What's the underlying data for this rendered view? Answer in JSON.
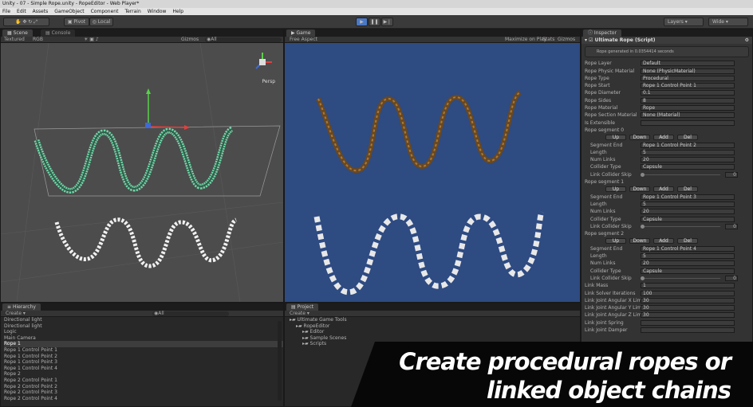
{
  "window": {
    "title": "Unity - 07 - Simple Rope.unity - RopeEditor - Web Player*"
  },
  "menu": [
    "File",
    "Edit",
    "Assets",
    "GameObject",
    "Component",
    "Terrain",
    "Window",
    "Help"
  ],
  "toolbar": {
    "pivot": "Pivot",
    "local": "Local",
    "layers": "Layers",
    "layout": "Wide"
  },
  "scene": {
    "tab": "Scene",
    "tab2": "Console",
    "mode": "Textured",
    "color": "RGB",
    "gizmos": "Gizmos",
    "search": "◉All",
    "persp": "Persp"
  },
  "game": {
    "tab": "Game",
    "aspect": "Free Aspect",
    "maximize": "Maximize on Play",
    "stats": "Stats",
    "gizmos": "Gizmos"
  },
  "inspector": {
    "tab": "Inspector",
    "component": "Ultimate Rope (Script)",
    "info": "Rope generated in 0.0354414 seconds",
    "fields": [
      {
        "label": "Rope Layer",
        "value": "Default"
      },
      {
        "label": "Rope Physic Material",
        "value": "None (PhysicMaterial)"
      },
      {
        "label": "Rope Type",
        "value": "Procedural"
      },
      {
        "label": "Rope Start",
        "value": "Rope 1 Control Point 1"
      },
      {
        "label": "Rope Diameter",
        "value": "0.1"
      },
      {
        "label": "Rope Sides",
        "value": "8"
      },
      {
        "label": "Rope Material",
        "value": "Rope"
      },
      {
        "label": "Rope Section Material",
        "value": "None (Material)"
      },
      {
        "label": "Is Extensible",
        "value": ""
      }
    ],
    "segments": [
      {
        "title": "Rope segment 0",
        "end": "Rope 1 Control Point 2",
        "length": "5",
        "links": "20",
        "collider": "Capsule",
        "skip": "0"
      },
      {
        "title": "Rope segment 1",
        "end": "Rope 1 Control Point 3",
        "length": "5",
        "links": "20",
        "collider": "Capsule",
        "skip": "0"
      },
      {
        "title": "Rope segment 2",
        "end": "Rope 1 Control Point 4",
        "length": "5",
        "links": "20",
        "collider": "Capsule",
        "skip": "0"
      }
    ],
    "labels": {
      "end": "Segment End",
      "length": "Length",
      "links": "Num Links",
      "collider": "Collider Type",
      "skip": "Link Collider Skip",
      "up": "Up",
      "down": "Down",
      "add": "Add",
      "del": "Del"
    },
    "bottom": [
      {
        "label": "Link Mass",
        "value": "1"
      },
      {
        "label": "Link Solver Iterations",
        "value": "100"
      },
      {
        "label": "Link Joint Angular X Limit",
        "value": "30"
      },
      {
        "label": "Link Joint Angular Y Limit",
        "value": "30"
      },
      {
        "label": "Link Joint Angular Z Limit",
        "value": "30"
      },
      {
        "label": "Link Joint Spring",
        "value": ""
      },
      {
        "label": "Link Joint Damper",
        "value": ""
      }
    ]
  },
  "hierarchy": {
    "tab": "Hierarchy",
    "create": "Create ▾",
    "search": "◉All",
    "items": [
      "Directional light",
      "Directional light",
      "Logic",
      "Main Camera",
      "Rope 1",
      "Rope 1 Control Point 1",
      "Rope 1 Control Point 2",
      "Rope 1 Control Point 3",
      "Rope 1 Control Point 4",
      "Rope 2",
      "Rope 2 Control Point 1",
      "Rope 2 Control Point 2",
      "Rope 2 Control Point 3",
      "Rope 2 Control Point 4"
    ]
  },
  "project": {
    "tab": "Project",
    "create": "Create ▾",
    "search": "◉All",
    "items": [
      "Ultimate Game Tools",
      "RopeEditor",
      "Editor",
      "Sample Scenes",
      "Scripts"
    ]
  },
  "banner": {
    "line1": "Create procedural ropes or",
    "line2": "linked object chains"
  },
  "colors": {
    "scene_bg": "#4a4a4a",
    "game_bg": "#2e4b82",
    "selection": "#3d6ab5"
  }
}
